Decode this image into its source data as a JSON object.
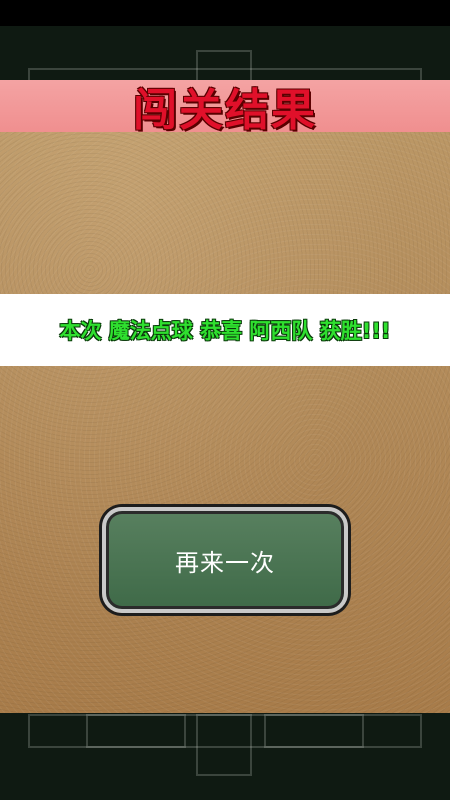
{
  "title": "闯关结果",
  "result": {
    "message": "本次 魔法点球 恭喜 阿西队 获胜!!!"
  },
  "retry_button": {
    "label": "再来一次"
  },
  "colors": {
    "title": "#e0102a",
    "title_band": "#f4a3a3",
    "result_text": "#2fe02f",
    "button_fill": "#4a7552"
  }
}
